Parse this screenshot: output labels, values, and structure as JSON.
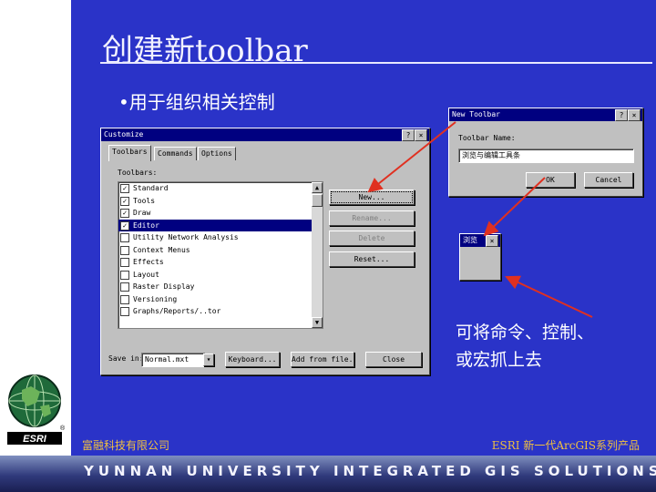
{
  "slide": {
    "title": "创建新toolbar",
    "bullet": "•用于组织相关控制",
    "callout_line1": "可将命令、控制、",
    "callout_line2": "或宏抓上去",
    "footer_left": "富融科技有限公司",
    "footer_right": "ESRI 新一代ArcGIS系列产品",
    "band_text": "YUNNAN UNIVERSITY INTEGRATED GIS SOLUTIONS",
    "logo_text": "ESRI",
    "registered_mark": "®"
  },
  "colors": {
    "slide_bg": "#2a33c8",
    "title_bar": "#000080",
    "arrow": "#e03020",
    "footer_text": "#f0c040"
  },
  "customize_dialog": {
    "title": "Customize",
    "help_button": "?",
    "close_button": "×",
    "tabs": [
      "Toolbars",
      "Commands",
      "Options"
    ],
    "list_label": "Toolbars:",
    "items": [
      {
        "label": "Standard",
        "checked": true,
        "selected": false
      },
      {
        "label": "Tools",
        "checked": true,
        "selected": false
      },
      {
        "label": "Draw",
        "checked": true,
        "selected": false
      },
      {
        "label": "Editor",
        "checked": true,
        "selected": true
      },
      {
        "label": "Utility Network Analysis",
        "checked": false,
        "selected": false
      },
      {
        "label": "Context Menus",
        "checked": false,
        "selected": false
      },
      {
        "label": "Effects",
        "checked": false,
        "selected": false
      },
      {
        "label": "Layout",
        "checked": false,
        "selected": false
      },
      {
        "label": "Raster Display",
        "checked": false,
        "selected": false
      },
      {
        "label": "Versioning",
        "checked": false,
        "selected": false
      },
      {
        "label": "Graphs/Reports/..tor",
        "checked": false,
        "selected": false
      }
    ],
    "buttons": {
      "new": "New...",
      "rename": "Rename...",
      "delete": "Delete",
      "reset": "Reset..."
    },
    "save_in_label": "Save in:",
    "save_in_value": "Normal.mxt",
    "keyboard": "Keyboard...",
    "add_from_file": "Add from file...",
    "close": "Close"
  },
  "new_toolbar_dialog": {
    "title": "New Toolbar",
    "help_button": "?",
    "close_button": "×",
    "name_label": "Toolbar Name:",
    "name_value": "浏览与编辑工具条",
    "ok": "OK",
    "cancel": "Cancel"
  },
  "mini_toolbar": {
    "title": "浏览",
    "close_button": "×"
  }
}
